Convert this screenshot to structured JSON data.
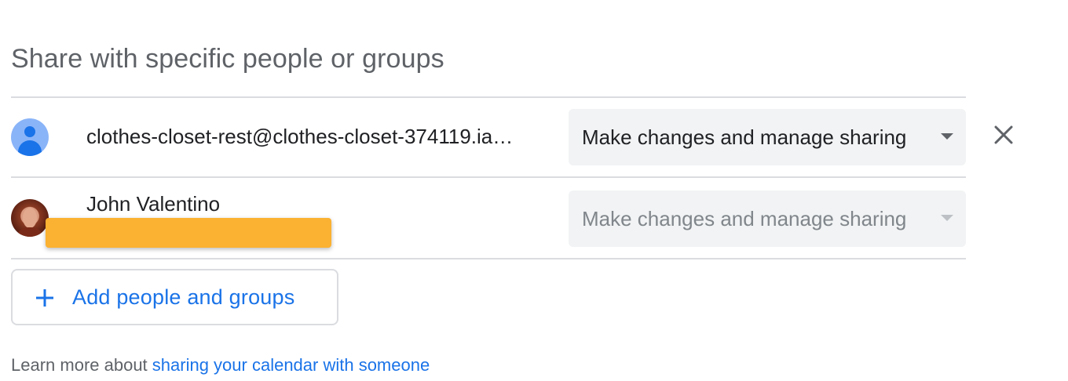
{
  "section": {
    "title": "Share with specific people or groups"
  },
  "people": [
    {
      "name": "clothes-closet-rest@clothes-closet-374119.ia…",
      "avatar": "generic-person-icon",
      "permission": "Make changes and manage sharing",
      "permission_disabled": false,
      "removable": true
    },
    {
      "name": "John Valentino",
      "avatar": "photo",
      "permission": "Make changes and manage sharing",
      "permission_disabled": true,
      "removable": false,
      "email_redacted": true
    }
  ],
  "add_button": {
    "label": "Add people and groups",
    "icon": "plus-icon"
  },
  "footer": {
    "prefix": "Learn more about ",
    "link": "sharing your calendar with someone"
  },
  "colors": {
    "accent": "#1a73e8",
    "redaction": "#fbb131",
    "select_bg": "#f1f3f4",
    "divider": "#dadce0"
  }
}
